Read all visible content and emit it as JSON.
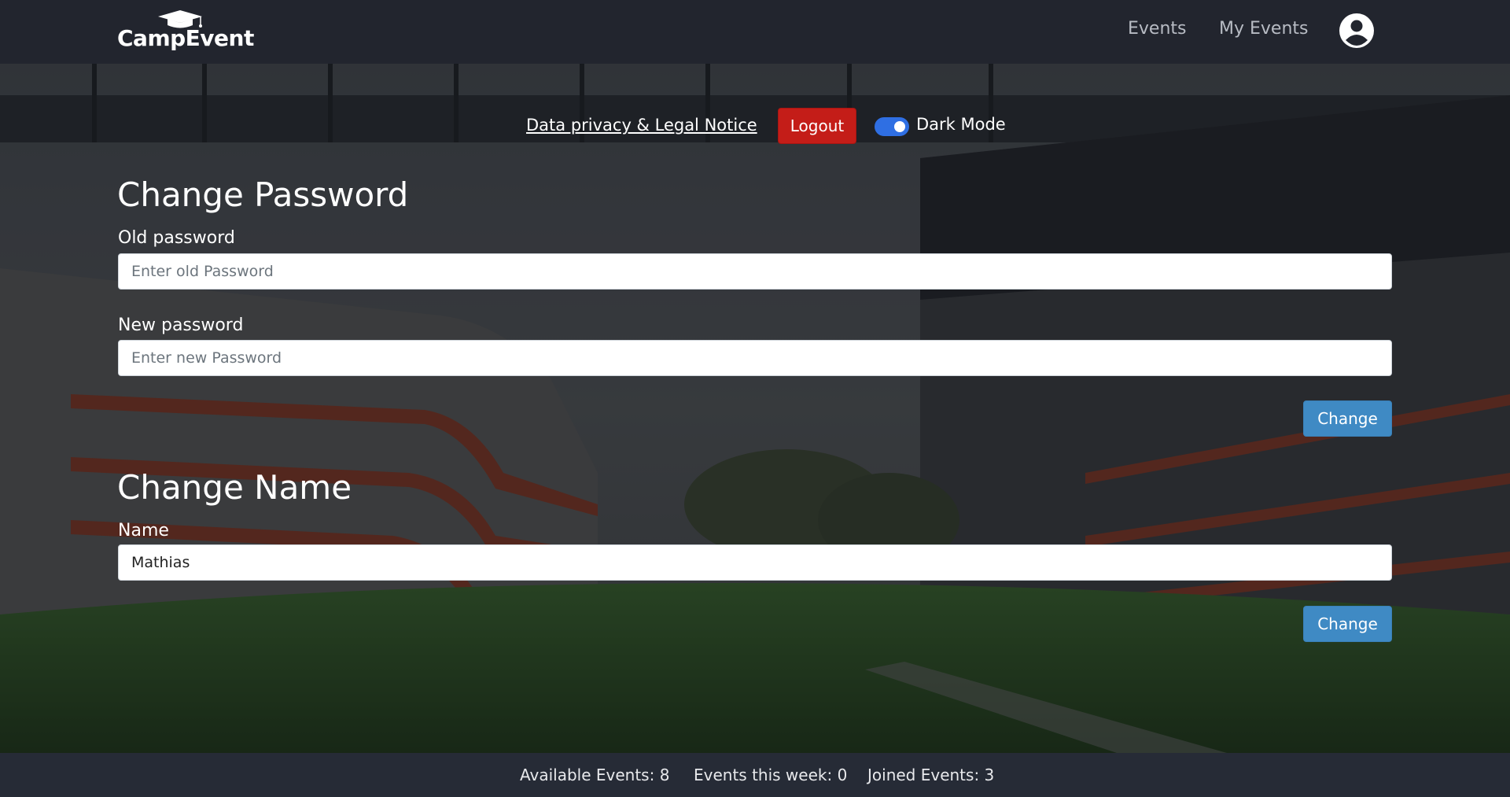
{
  "brand": {
    "name": "CampEvent",
    "logo_icon": "graduation-cap-icon"
  },
  "nav": {
    "events_label": "Events",
    "my_events_label": "My Events",
    "avatar_icon": "user-avatar-icon"
  },
  "topbar": {
    "legal_link": "Data privacy & Legal Notice",
    "logout_label": "Logout",
    "dark_mode_label": "Dark Mode",
    "dark_mode_on": true
  },
  "change_password": {
    "title": "Change Password",
    "old_label": "Old password",
    "old_placeholder": "Enter old Password",
    "new_label": "New password",
    "new_placeholder": "Enter new Password",
    "button_label": "Change"
  },
  "change_name": {
    "title": "Change Name",
    "name_label": "Name",
    "name_value": "Mathias",
    "button_label": "Change"
  },
  "footer": {
    "available_events": "Available Events: 8",
    "events_this_week": "Events this week: 0",
    "joined_events": "Joined Events: 3"
  },
  "colors": {
    "navbar": "#22252e",
    "footer": "#262b36",
    "logout": "#c41d18",
    "change_button": "#3f8ac4",
    "toggle": "#2f6fe3"
  }
}
